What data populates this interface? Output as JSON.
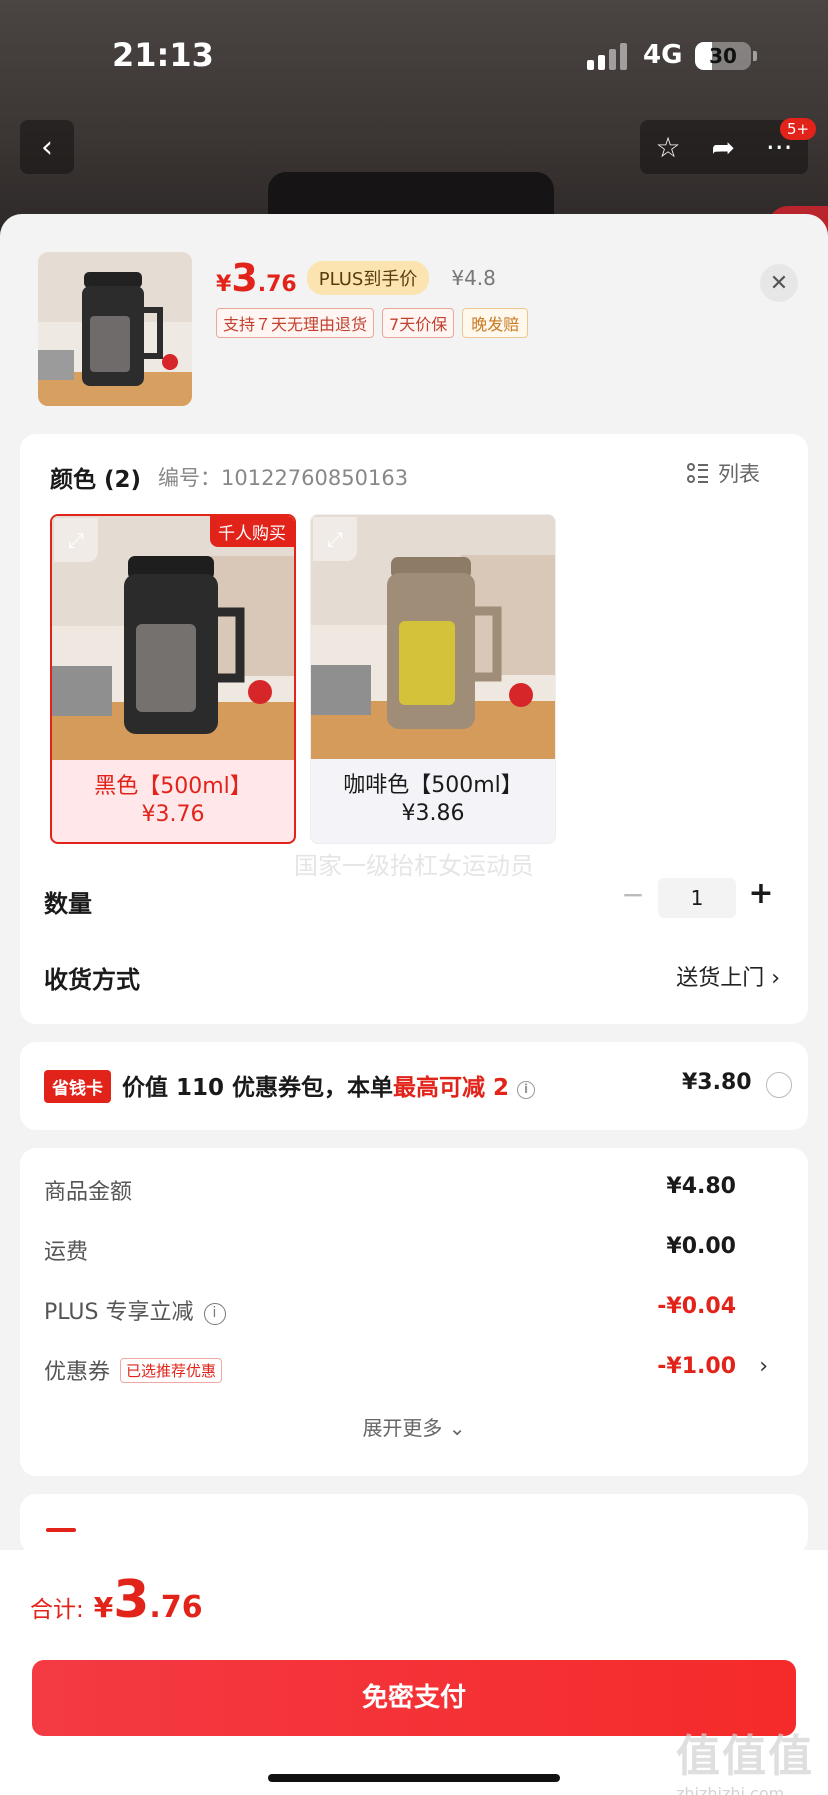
{
  "status": {
    "time": "21:13",
    "network": "4G",
    "battery": "30",
    "battery_level": 0.3
  },
  "nav": {
    "back_icon": "chevron-left-icon",
    "notification_badge": "5+"
  },
  "product": {
    "price_symbol": "¥",
    "price_int": "3",
    "price_dec": ".76",
    "plus_tag": "PLUS到手价",
    "original_price": "¥4.8",
    "services": [
      "支持７天无理由退货",
      "7天价保",
      "晚发赔"
    ]
  },
  "spec": {
    "title": "颜色 (2)",
    "code": "编号：10122760850163",
    "list_toggle": "列表",
    "hot_tag": "千人购买",
    "variants": [
      {
        "name": "黑色【500ml】",
        "price": "¥3.76",
        "selected": true,
        "cup_color": "#2c2c2c"
      },
      {
        "name": "咖啡色【500ml】",
        "price": "¥3.86",
        "selected": false,
        "cup_color": "#a08d78"
      }
    ],
    "watermark": "国家一级抬杠女运动员"
  },
  "quantity": {
    "label": "数量",
    "value": "1",
    "minus": "−",
    "plus": "+"
  },
  "shipping": {
    "label": "收货方式",
    "value": "送货上门 ›"
  },
  "saver": {
    "badge": "省钱卡",
    "text_prefix": "价值 110 优惠券包，本单",
    "text_highlight": "最高可减 2",
    "price": "¥3.80"
  },
  "summary": {
    "rows": [
      {
        "label": "商品金额",
        "value": "¥4.80"
      },
      {
        "label": "运费",
        "value": "¥0.00"
      },
      {
        "label": "PLUS 专享立减",
        "value": "-¥0.04"
      },
      {
        "label": "优惠券",
        "tag": "已选推荐优惠",
        "value": "-¥1.00"
      }
    ],
    "expand": "展开更多 ⌄"
  },
  "footer": {
    "total_label": "合计:",
    "total_symbol": "¥",
    "total_int": "3",
    "total_dec": ".76",
    "pay_button": "免密支付",
    "site_mark_big": "值值值",
    "site_mark_small": "zhizhizhi.com"
  },
  "colors": {
    "accent": "#e2231a",
    "plus_tag_bg": "#fbe4b0"
  }
}
